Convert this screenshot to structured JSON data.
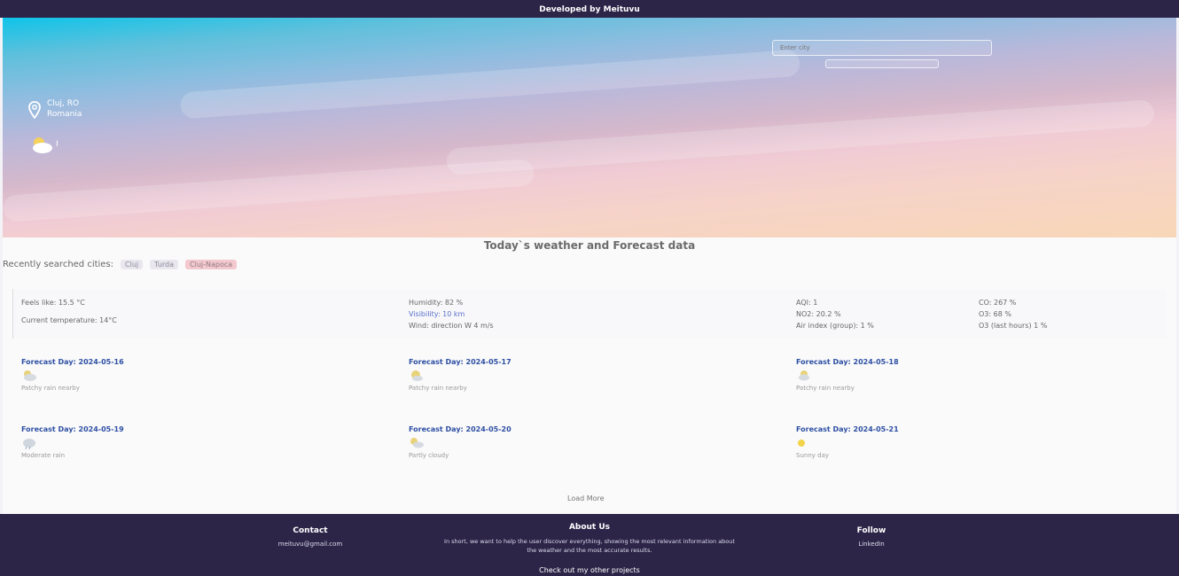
{
  "topbar": {
    "label": "Developed by Meituvu"
  },
  "hero": {
    "search_placeholder": "Enter city",
    "city_name": "Cluj, RO",
    "city_sub": "Romania",
    "temp": "I"
  },
  "section_title": "Today`s weather and Forecast data",
  "recent": {
    "label": "Recently searched cities:",
    "cities": [
      "Cluj",
      "Turda",
      "Cluj-Napoca"
    ]
  },
  "today": {
    "feels_like": "Feels like: 15.5 °C",
    "current_temp": "Current temperature: 14°C",
    "humidity": "Humidity: 82 %",
    "visibility": "Visibility: 10 km",
    "wind": "Wind: direction W 4 m/s",
    "aqi": "AQI: 1",
    "no2": "NO2: 20.2 %",
    "aqi_index": "Air index (group): 1 %",
    "co": "CO: 267 %",
    "o3": "O3: 68 %",
    "pollution": "O3 (last hours) 1 %"
  },
  "forecast": [
    {
      "title": "Forecast Day: 2024-05-16",
      "desc": "Patchy rain nearby"
    },
    {
      "title": "Forecast Day: 2024-05-17",
      "desc": "Patchy rain nearby"
    },
    {
      "title": "Forecast Day: 2024-05-18",
      "desc": "Patchy rain nearby"
    },
    {
      "title": "Forecast Day: 2024-05-19",
      "desc": "Moderate rain"
    },
    {
      "title": "Forecast Day: 2024-05-20",
      "desc": "Partly cloudy"
    },
    {
      "title": "Forecast Day: 2024-05-21",
      "desc": "Sunny day"
    }
  ],
  "load_more": "Load More",
  "footer": {
    "contact_title": "Contact",
    "contact_email": "meituvu@gmail.com",
    "about_title": "About Us",
    "about_text": "In short, we want to help the user discover everything, showing the most relevant information about the weather and the most accurate results.",
    "follow_title": "Follow",
    "follow_link": "LinkedIn",
    "other_projects": "Check out my other projects"
  }
}
